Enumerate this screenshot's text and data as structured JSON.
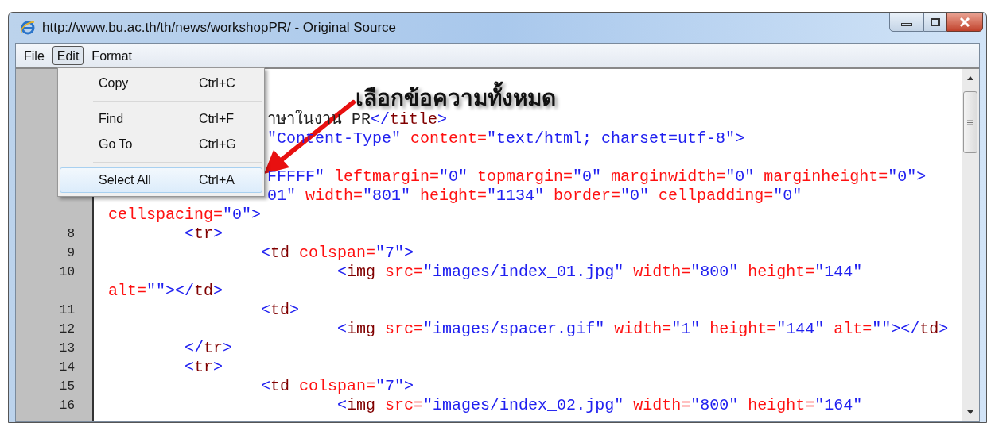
{
  "window": {
    "title": "http://www.bu.ac.th/th/news/workshopPR/ - Original Source"
  },
  "menubar": [
    {
      "label": "File",
      "selected": false
    },
    {
      "label": "Edit",
      "selected": true
    },
    {
      "label": "Format",
      "selected": false
    }
  ],
  "edit_menu": {
    "groups": [
      [
        {
          "label": "Copy",
          "shortcut": "Ctrl+C",
          "selected": false
        }
      ],
      [
        {
          "label": "Find",
          "shortcut": "Ctrl+F",
          "selected": false
        },
        {
          "label": "Go To",
          "shortcut": "Ctrl+G",
          "selected": false
        }
      ],
      [
        {
          "label": "Select All",
          "shortcut": "Ctrl+A",
          "selected": true
        }
      ]
    ]
  },
  "annotation": {
    "text": "เลือกข้อความทั้งหมด"
  },
  "code_lines": [
    {
      "kind": "covered",
      "tokens": [
        {
          "kind": "text",
          "text": "าษาในงาน PR"
        },
        {
          "kind": "bracket",
          "text": "</"
        },
        {
          "kind": "tag",
          "text": "title"
        },
        {
          "kind": "bracket",
          "text": ">"
        }
      ]
    },
    {
      "kind": "covered",
      "tokens": [
        {
          "kind": "value",
          "text": "\"Content-Type\""
        },
        {
          "kind": "attribute",
          "text": " content="
        },
        {
          "kind": "value",
          "text": "\"text/html; charset=utf-8\""
        },
        {
          "kind": "bracket",
          "text": ">"
        }
      ]
    },
    {
      "kind": "covered"
    },
    {
      "kind": "covered",
      "tokens": [
        {
          "kind": "value",
          "text": "FFFFF\""
        },
        {
          "kind": "attribute",
          "text": " leftmargin="
        },
        {
          "kind": "value",
          "text": "\"0\""
        },
        {
          "kind": "attribute",
          "text": " topmargin="
        },
        {
          "kind": "value",
          "text": "\"0\""
        },
        {
          "kind": "attribute",
          "text": " marginwidth="
        },
        {
          "kind": "value",
          "text": "\"0\""
        },
        {
          "kind": "attribute",
          "text": " marginheight="
        },
        {
          "kind": "value",
          "text": "\"0\""
        },
        {
          "kind": "bracket",
          "text": ">"
        }
      ]
    },
    {
      "kind": "covered",
      "tokens": [
        {
          "kind": "value",
          "text": "01\""
        },
        {
          "kind": "attribute",
          "text": " width="
        },
        {
          "kind": "value",
          "text": "\"801\""
        },
        {
          "kind": "attribute",
          "text": " height="
        },
        {
          "kind": "value",
          "text": "\"1134\""
        },
        {
          "kind": "attribute",
          "text": " border="
        },
        {
          "kind": "value",
          "text": "\"0\""
        },
        {
          "kind": "attribute",
          "text": " cellpadding="
        },
        {
          "kind": "value",
          "text": "\"0\""
        }
      ]
    },
    {
      "kind": "line",
      "tokens": [
        {
          "kind": "attribute",
          "text": "cellspacing="
        },
        {
          "kind": "value",
          "text": "\"0\""
        },
        {
          "kind": "bracket",
          "text": ">"
        }
      ]
    },
    {
      "kind": "line",
      "number": "8",
      "tokens": [
        {
          "kind": "bracket",
          "text": "\t<"
        },
        {
          "kind": "tag",
          "text": "tr"
        },
        {
          "kind": "bracket",
          "text": ">"
        }
      ]
    },
    {
      "kind": "line",
      "number": "9",
      "tokens": [
        {
          "kind": "bracket",
          "text": "\t\t<"
        },
        {
          "kind": "tag",
          "text": "td"
        },
        {
          "kind": "attribute",
          "text": " colspan="
        },
        {
          "kind": "value",
          "text": "\"7\""
        },
        {
          "kind": "bracket",
          "text": ">"
        }
      ]
    },
    {
      "kind": "line",
      "number": "10",
      "tokens": [
        {
          "kind": "bracket",
          "text": "\t\t\t<"
        },
        {
          "kind": "tag",
          "text": "img"
        },
        {
          "kind": "attribute",
          "text": " src="
        },
        {
          "kind": "value",
          "text": "\"images/index_01.jpg\""
        },
        {
          "kind": "attribute",
          "text": " width="
        },
        {
          "kind": "value",
          "text": "\"800\""
        },
        {
          "kind": "attribute",
          "text": " height="
        },
        {
          "kind": "value",
          "text": "\"144\""
        }
      ]
    },
    {
      "kind": "line",
      "tokens": [
        {
          "kind": "attribute",
          "text": "alt="
        },
        {
          "kind": "value",
          "text": "\"\""
        },
        {
          "kind": "bracket",
          "text": "></"
        },
        {
          "kind": "tag",
          "text": "td"
        },
        {
          "kind": "bracket",
          "text": ">"
        }
      ]
    },
    {
      "kind": "line",
      "number": "11",
      "tokens": [
        {
          "kind": "bracket",
          "text": "\t\t<"
        },
        {
          "kind": "tag",
          "text": "td"
        },
        {
          "kind": "bracket",
          "text": ">"
        }
      ]
    },
    {
      "kind": "line",
      "number": "12",
      "tokens": [
        {
          "kind": "bracket",
          "text": "\t\t\t<"
        },
        {
          "kind": "tag",
          "text": "img"
        },
        {
          "kind": "attribute",
          "text": " src="
        },
        {
          "kind": "value",
          "text": "\"images/spacer.gif\""
        },
        {
          "kind": "attribute",
          "text": " width="
        },
        {
          "kind": "value",
          "text": "\"1\""
        },
        {
          "kind": "attribute",
          "text": " height="
        },
        {
          "kind": "value",
          "text": "\"144\""
        },
        {
          "kind": "attribute",
          "text": " alt="
        },
        {
          "kind": "value",
          "text": "\"\""
        },
        {
          "kind": "bracket",
          "text": "></"
        },
        {
          "kind": "tag",
          "text": "td"
        },
        {
          "kind": "bracket",
          "text": ">"
        }
      ]
    },
    {
      "kind": "line",
      "number": "13",
      "tokens": [
        {
          "kind": "bracket",
          "text": "\t</"
        },
        {
          "kind": "tag",
          "text": "tr"
        },
        {
          "kind": "bracket",
          "text": ">"
        }
      ]
    },
    {
      "kind": "line",
      "number": "14",
      "tokens": [
        {
          "kind": "bracket",
          "text": "\t<"
        },
        {
          "kind": "tag",
          "text": "tr"
        },
        {
          "kind": "bracket",
          "text": ">"
        }
      ]
    },
    {
      "kind": "line",
      "number": "15",
      "tokens": [
        {
          "kind": "bracket",
          "text": "\t\t<"
        },
        {
          "kind": "tag",
          "text": "td"
        },
        {
          "kind": "attribute",
          "text": " colspan="
        },
        {
          "kind": "value",
          "text": "\"7\""
        },
        {
          "kind": "bracket",
          "text": ">"
        }
      ]
    },
    {
      "kind": "line",
      "number": "16",
      "tokens": [
        {
          "kind": "bracket",
          "text": "\t\t\t<"
        },
        {
          "kind": "tag",
          "text": "img"
        },
        {
          "kind": "attribute",
          "text": " src="
        },
        {
          "kind": "value",
          "text": "\"images/index_02.jpg\""
        },
        {
          "kind": "attribute",
          "text": " width="
        },
        {
          "kind": "value",
          "text": "\"800\""
        },
        {
          "kind": "attribute",
          "text": " height="
        },
        {
          "kind": "value",
          "text": "\"164\""
        }
      ]
    }
  ]
}
